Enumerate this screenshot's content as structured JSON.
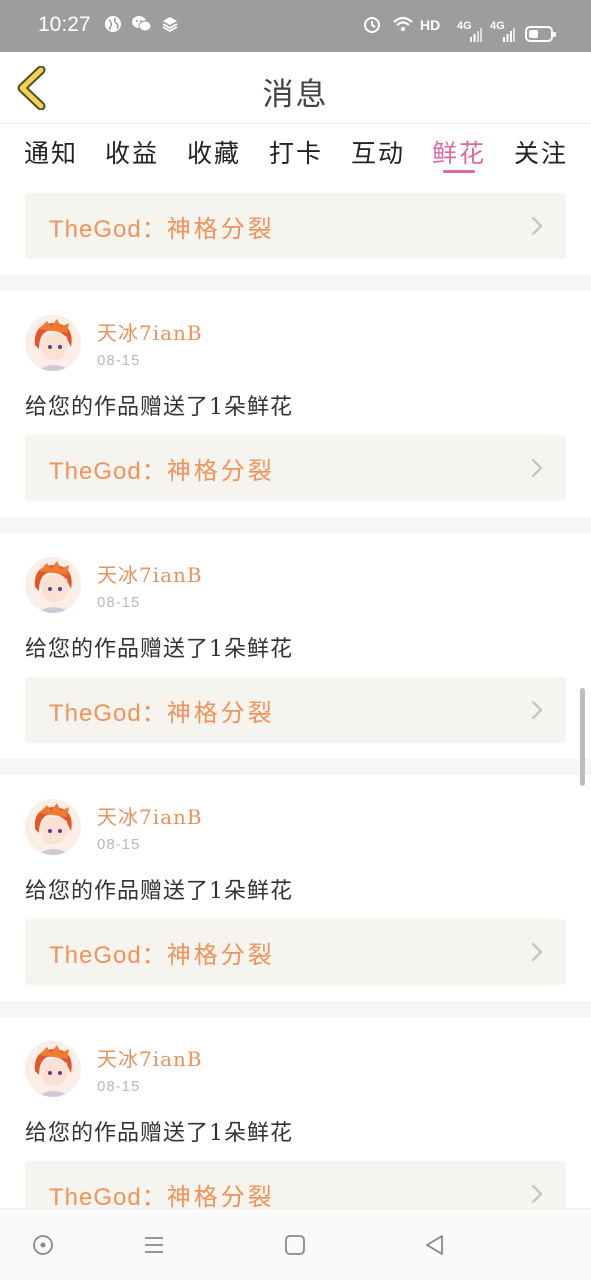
{
  "status_bar": {
    "time": "10:27",
    "net1": "HD",
    "net2": "4G",
    "net3": "4G"
  },
  "header": {
    "title": "消息"
  },
  "tabs": [
    {
      "label": "通知"
    },
    {
      "label": "收益"
    },
    {
      "label": "收藏"
    },
    {
      "label": "打卡"
    },
    {
      "label": "互动"
    },
    {
      "label": "鲜花"
    },
    {
      "label": "关注"
    }
  ],
  "active_tab": "鲜花",
  "top_card": {
    "work_prefix": "TheGod：",
    "work_name": "神格分裂"
  },
  "notifications": [
    {
      "username": "天冰7ianB",
      "date": "08-15",
      "message": "给您的作品赠送了1朵鲜花",
      "work_prefix": "TheGod：",
      "work_name": "神格分裂"
    },
    {
      "username": "天冰7ianB",
      "date": "08-15",
      "message": "给您的作品赠送了1朵鲜花",
      "work_prefix": "TheGod：",
      "work_name": "神格分裂"
    },
    {
      "username": "天冰7ianB",
      "date": "08-15",
      "message": "给您的作品赠送了1朵鲜花",
      "work_prefix": "TheGod：",
      "work_name": "神格分裂"
    },
    {
      "username": "天冰7ianB",
      "date": "08-15",
      "message": "给您的作品赠送了1朵鲜花",
      "work_prefix": "TheGod：",
      "work_name": "神格分裂"
    }
  ],
  "colors": {
    "accent": "#e0679f",
    "work_text": "#f0925a",
    "username": "#e8935c",
    "status_bar": "#9d9d9d"
  },
  "icons": {
    "back": "chevron-left-icon",
    "arrow": "chevron-right-icon",
    "nav": [
      "circle-dot-icon",
      "menu-icon",
      "square-icon",
      "triangle-back-icon"
    ]
  }
}
